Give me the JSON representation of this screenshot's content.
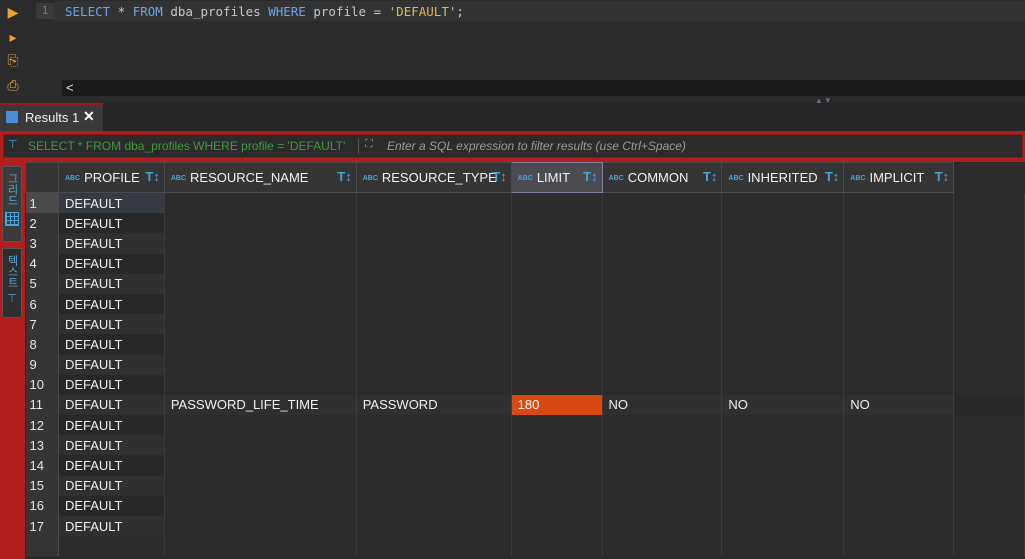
{
  "editor": {
    "line_number": "1",
    "sql_tokens": [
      {
        "t": "SELECT",
        "k": "kw"
      },
      {
        "t": " * ",
        "k": "id"
      },
      {
        "t": "FROM",
        "k": "kw"
      },
      {
        "t": " dba_profiles ",
        "k": "id"
      },
      {
        "t": "WHERE",
        "k": "kw"
      },
      {
        "t": " profile = ",
        "k": "id"
      },
      {
        "t": "'DEFAULT'",
        "k": "str"
      },
      {
        "t": ";",
        "k": "id"
      }
    ],
    "scroll_left": "<"
  },
  "results_tab": {
    "label": "Results 1",
    "close": "✕"
  },
  "filter": {
    "current_sql": "SELECT * FROM dba_profiles WHERE profile = 'DEFAULT'",
    "placeholder": "Enter a SQL expression to filter results (use Ctrl+Space)"
  },
  "side_panel": {
    "grid_label": "그리드",
    "text_label": "텍스트"
  },
  "grid": {
    "type_badge": "ABC",
    "columns": [
      "PROFILE",
      "RESOURCE_NAME",
      "RESOURCE_TYPE",
      "LIMIT",
      "COMMON",
      "INHERITED",
      "IMPLICIT"
    ],
    "rows": [
      {
        "n": "1",
        "cells": [
          "DEFAULT"
        ]
      },
      {
        "n": "2",
        "cells": [
          "DEFAULT"
        ]
      },
      {
        "n": "3",
        "cells": [
          "DEFAULT"
        ]
      },
      {
        "n": "4",
        "cells": [
          "DEFAULT"
        ]
      },
      {
        "n": "5",
        "cells": [
          "DEFAULT"
        ]
      },
      {
        "n": "6",
        "cells": [
          "DEFAULT"
        ]
      },
      {
        "n": "7",
        "cells": [
          "DEFAULT"
        ]
      },
      {
        "n": "8",
        "cells": [
          "DEFAULT"
        ]
      },
      {
        "n": "9",
        "cells": [
          "DEFAULT"
        ]
      },
      {
        "n": "10",
        "cells": [
          "DEFAULT"
        ]
      },
      {
        "n": "11",
        "cells": [
          "DEFAULT",
          "PASSWORD_LIFE_TIME",
          "PASSWORD",
          "180",
          "NO",
          "NO",
          "NO"
        ]
      },
      {
        "n": "12",
        "cells": [
          "DEFAULT"
        ]
      },
      {
        "n": "13",
        "cells": [
          "DEFAULT"
        ]
      },
      {
        "n": "14",
        "cells": [
          "DEFAULT"
        ]
      },
      {
        "n": "15",
        "cells": [
          "DEFAULT"
        ]
      },
      {
        "n": "16",
        "cells": [
          "DEFAULT"
        ]
      },
      {
        "n": "17",
        "cells": [
          "DEFAULT"
        ]
      }
    ],
    "selected_cell": {
      "row": "11",
      "column": "LIMIT"
    }
  },
  "colors": {
    "accent_red": "#b01e1e",
    "selection": "#d94a12",
    "keyword_blue": "#6fa6e8",
    "string_yellow": "#e6b450"
  }
}
